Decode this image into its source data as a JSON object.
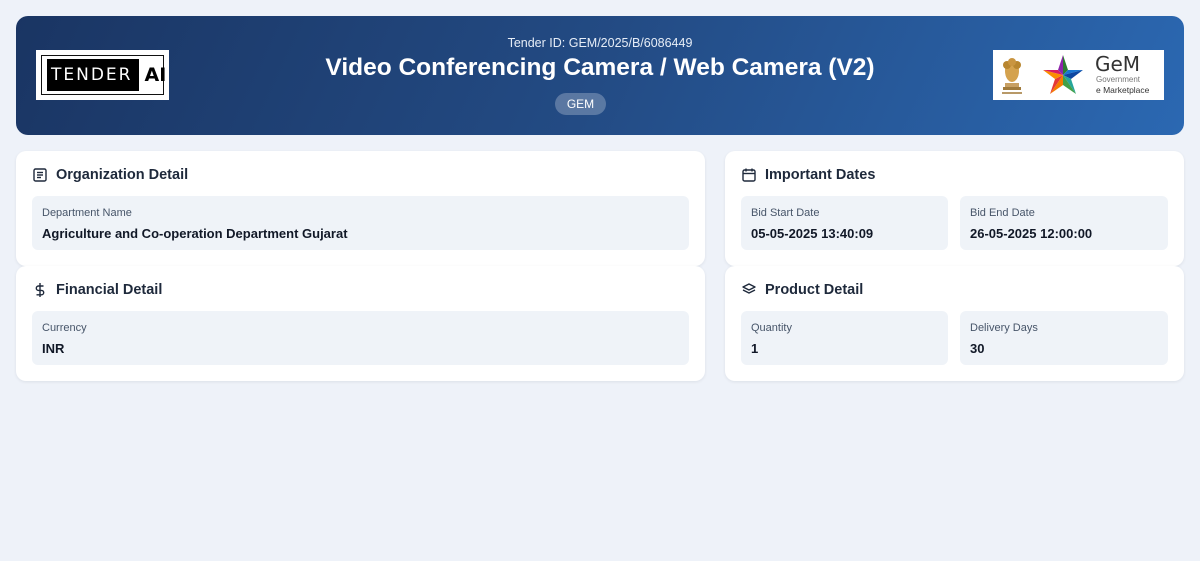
{
  "header": {
    "tender_id": "Tender ID: GEM/2025/B/6086449",
    "title": "Video Conferencing Camera / Web Camera (V2)",
    "badge": "GEM",
    "brand_left": {
      "part1": "TENDER",
      "part2": "AI"
    },
    "brand_right": {
      "name": "GeM",
      "line1": "Government",
      "line2": "e Marketplace"
    }
  },
  "organization": {
    "title": "Organization Detail",
    "icon": "document-icon",
    "fields": [
      {
        "label": "Department Name",
        "value": "Agriculture and Co-operation Department Gujarat"
      }
    ]
  },
  "dates": {
    "title": "Important Dates",
    "icon": "calendar-icon",
    "fields": [
      {
        "label": "Bid Start Date",
        "value": "05-05-2025 13:40:09"
      },
      {
        "label": "Bid End Date",
        "value": "26-05-2025 12:00:00"
      }
    ]
  },
  "financial": {
    "title": "Financial Detail",
    "icon": "dollar-icon",
    "fields": [
      {
        "label": "Currency",
        "value": "INR"
      }
    ]
  },
  "product": {
    "title": "Product Detail",
    "icon": "layers-icon",
    "fields": [
      {
        "label": "Quantity",
        "value": "1"
      },
      {
        "label": "Delivery Days",
        "value": "30"
      }
    ]
  },
  "colors": {
    "header_start": "#1a3563",
    "header_end": "#2b68b2",
    "background": "#eef2f9",
    "field_bg": "#eff3f8"
  }
}
